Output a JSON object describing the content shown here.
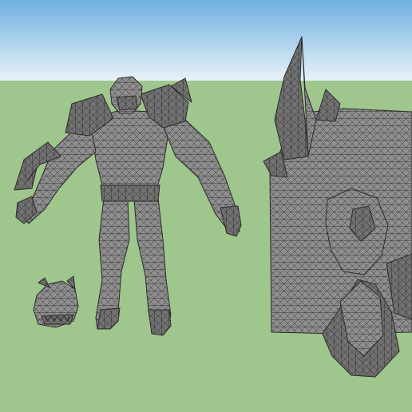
{
  "viewport": {
    "sky_top_color": "#6fb0e0",
    "sky_bottom_color": "#e8f2f8",
    "ground_color": "#9fc68c",
    "model_fill_color": "#8f8f8f",
    "model_dark_color": "#6a6a6a",
    "mesh_line_color": "#2b2b2b"
  },
  "models": [
    {
      "name": "armored-warrior"
    },
    {
      "name": "small-creature"
    },
    {
      "name": "horned-beast-head"
    }
  ]
}
